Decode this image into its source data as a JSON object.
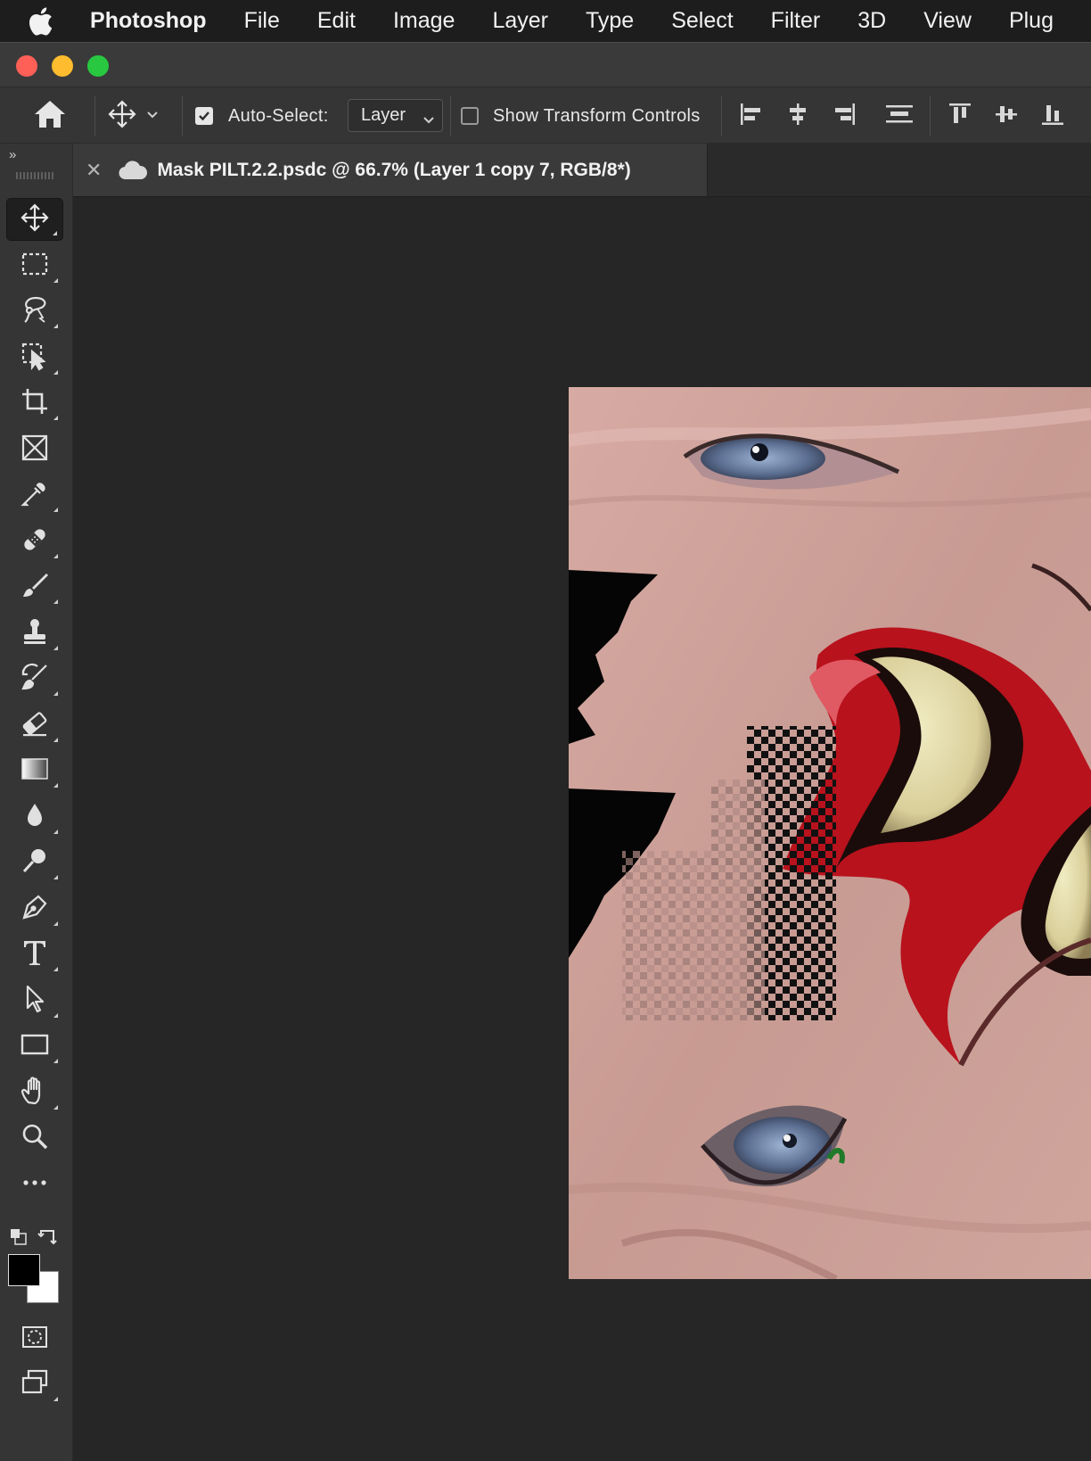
{
  "menubar": {
    "app_name": "Photoshop",
    "items": [
      "File",
      "Edit",
      "Image",
      "Layer",
      "Type",
      "Select",
      "Filter",
      "3D",
      "View",
      "Plug"
    ]
  },
  "options_bar": {
    "auto_select_label": "Auto-Select:",
    "auto_select_checked": true,
    "auto_select_value": "Layer",
    "show_transform_label": "Show Transform Controls",
    "show_transform_checked": false
  },
  "document": {
    "tab_title": "Mask PILT.2.2.psdc @ 66.7% (Layer 1 copy 7, RGB/8*)"
  },
  "toolbar": {
    "collapse_label": "»",
    "active_tool": "move-tool",
    "tools": [
      "move-tool",
      "marquee-tool",
      "lasso-tool",
      "object-selection-tool",
      "crop-tool",
      "frame-tool",
      "eyedropper-tool",
      "healing-brush-tool",
      "brush-tool",
      "clone-stamp-tool",
      "history-brush-tool",
      "eraser-tool",
      "gradient-tool",
      "blur-tool",
      "dodge-tool",
      "pen-tool",
      "type-tool",
      "path-selection-tool",
      "rectangle-tool",
      "hand-tool",
      "zoom-tool",
      "edit-toolbar"
    ],
    "foreground_color": "#000000",
    "background_color": "#ffffff"
  },
  "colors": {
    "menubar_bg": "#1d1d1d",
    "panel_bg": "#353535",
    "canvas_bg": "#262626"
  }
}
